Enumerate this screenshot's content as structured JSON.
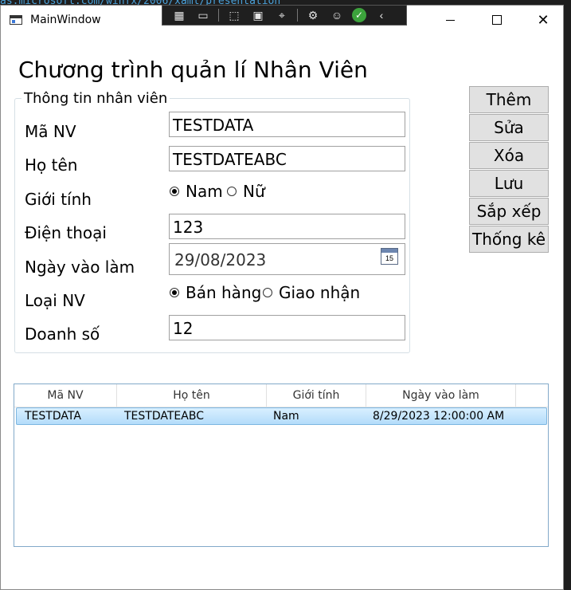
{
  "background_code": "as.microsoft.com/winfx/2006/xaml/presentation",
  "window": {
    "title": "MainWindow"
  },
  "heading": "Chương trình quản lí Nhân Viên",
  "group": {
    "title": "Thông tin nhân viên",
    "fields": {
      "ma_nv": {
        "label": "Mã NV",
        "value": "TESTDATA"
      },
      "ho_ten": {
        "label": "Họ tên",
        "value": "TESTDATEABC"
      },
      "gioi_tinh": {
        "label": "Giới tính",
        "options": [
          "Nam",
          "Nữ"
        ],
        "selected": "Nam"
      },
      "dien_thoai": {
        "label": "Điện thoại",
        "value": "123"
      },
      "ngay_vao_lam": {
        "label": "Ngày vào làm",
        "value": "29/08/2023",
        "calendar_day": "15"
      },
      "loai_nv": {
        "label": "Loại NV",
        "options": [
          "Bán hàng",
          "Giao nhận"
        ],
        "selected": "Bán hàng"
      },
      "doanh_so": {
        "label": "Doanh số",
        "value": "12"
      }
    }
  },
  "buttons": [
    "Thêm",
    "Sửa",
    "Xóa",
    "Lưu",
    "Sắp xếp",
    "Thống kê"
  ],
  "grid": {
    "columns": [
      "Mã NV",
      "Họ tên",
      "Giới tính",
      "Ngày vào làm"
    ],
    "rows": [
      [
        "TESTDATA",
        "TESTDATEABC",
        "Nam",
        "8/29/2023 12:00:00 AM"
      ]
    ]
  },
  "colors": {
    "selection": "#b3dcfa",
    "button_face": "#e1e1e1",
    "devbar": "#1f1f1f"
  }
}
